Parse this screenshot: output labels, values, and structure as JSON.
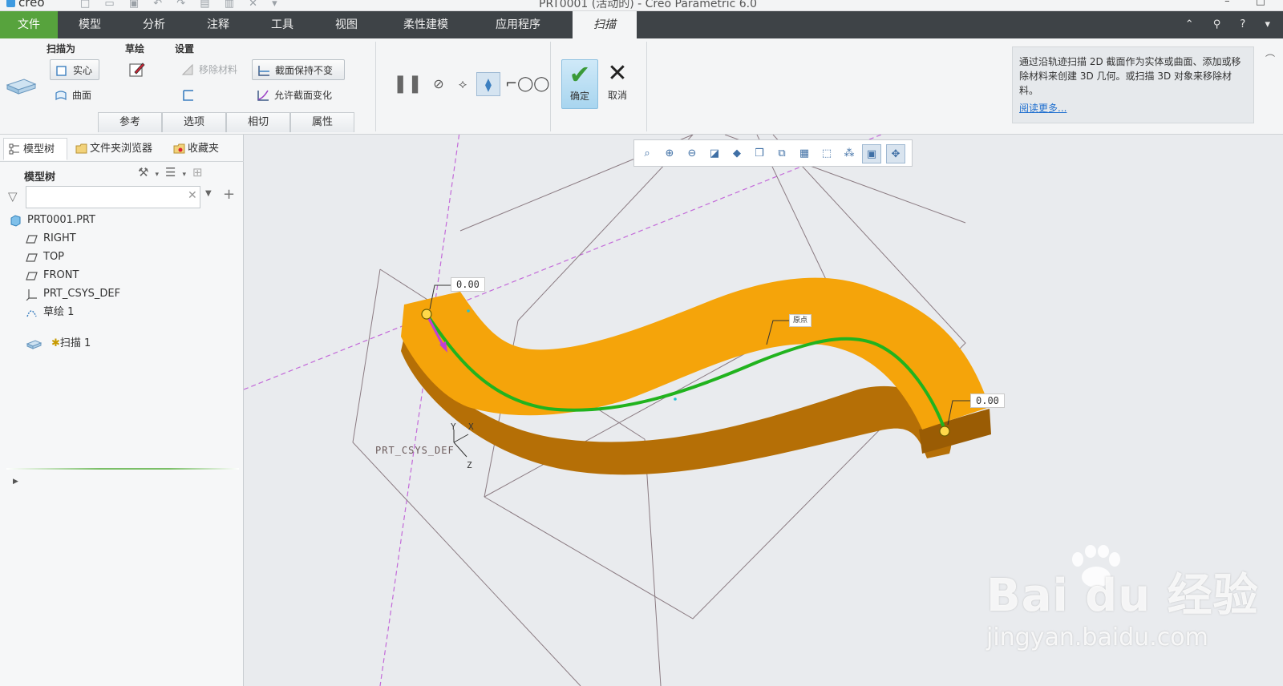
{
  "titlebar": {
    "brand": "creo",
    "window_title": "PRT0001 (活动的) - Creo Parametric 6.0"
  },
  "tabs": [
    {
      "label": "文件"
    },
    {
      "label": "模型"
    },
    {
      "label": "分析"
    },
    {
      "label": "注释"
    },
    {
      "label": "工具"
    },
    {
      "label": "视图"
    },
    {
      "label": "柔性建模"
    },
    {
      "label": "应用程序"
    },
    {
      "label": "扫描"
    }
  ],
  "ribbon": {
    "sweep_as_label": "扫描为",
    "solid_label": "实心",
    "surface_label": "曲面",
    "sketch_label": "草绘",
    "settings_label": "设置",
    "remove_material_label": "移除材料",
    "constant_section_label": "截面保持不变",
    "variable_section_label": "允许截面变化",
    "subtabs": [
      "参考",
      "选项",
      "相切",
      "属性"
    ],
    "ok_label": "确定",
    "cancel_label": "取消",
    "help_text": "通过沿轨迹扫描 2D 截面作为实体或曲面、添加或移除材料来创建 3D 几何。或扫描 3D 对象来移除材料。",
    "help_link": "阅读更多..."
  },
  "left_panel": {
    "tabs": [
      {
        "label": "模型树"
      },
      {
        "label": "文件夹浏览器"
      },
      {
        "label": "收藏夹"
      }
    ],
    "tree_title": "模型树",
    "search_value": "",
    "nodes": [
      {
        "label": "PRT0001.PRT"
      },
      {
        "label": "RIGHT"
      },
      {
        "label": "TOP"
      },
      {
        "label": "FRONT"
      },
      {
        "label": "PRT_CSYS_DEF"
      },
      {
        "label": "草绘 1"
      },
      {
        "label": "扫描 1"
      }
    ]
  },
  "viewport": {
    "dim_start": "0.00",
    "dim_end": "0.00",
    "origin_label": "原点",
    "csys_label": "PRT_CSYS_DEF",
    "axis_x": "X",
    "axis_y": "Y",
    "axis_z": "Z",
    "solid_color": "#f5a40a",
    "solid_side_color": "#b56f06",
    "trajectory_color": "#21b31e"
  },
  "watermark": {
    "brand": "Bai du 经验",
    "url": "jingyan.baidu.com"
  }
}
